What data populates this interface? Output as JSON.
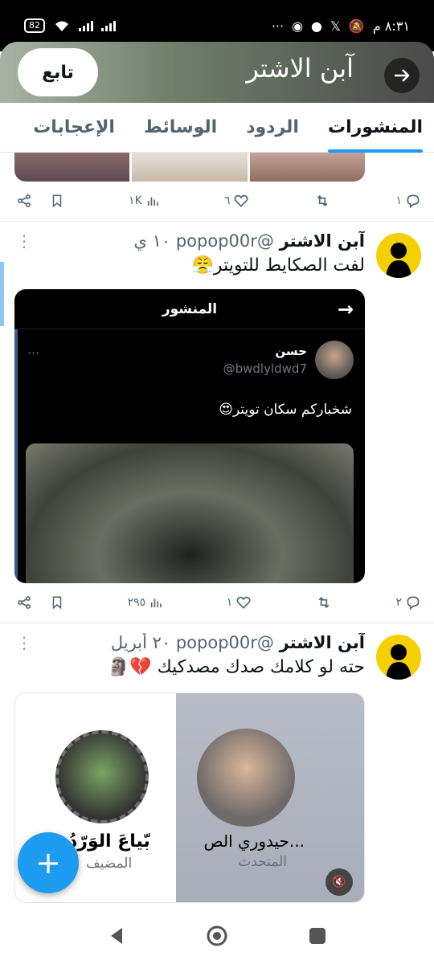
{
  "status_bar": {
    "time": "٨:٣١ م",
    "battery": "82",
    "dots": "···"
  },
  "header": {
    "title": "آبن الاشتر",
    "follow_label": "تابع"
  },
  "tabs": [
    {
      "label": "المنشورات",
      "active": true
    },
    {
      "label": "الردود",
      "active": false
    },
    {
      "label": "الوسائط",
      "active": false
    },
    {
      "label": "الإعجابات",
      "active": false
    }
  ],
  "tweet0": {
    "reply_count": "١",
    "like_count": "٦",
    "view_count": "١K"
  },
  "tweet1": {
    "name": "آبن الاشتر",
    "handle": "@popop00r",
    "time": "١٠ ي",
    "text": "لفت الصكايط للتويتر😤",
    "quote": {
      "bar_title": "المنشور",
      "author_name": "حسن",
      "author_handle": "@bwdlyldwd7",
      "text": "شخباركم سكان تويتر😍"
    },
    "reply_count": "٢",
    "like_count": "١",
    "view_count": "٢٩٥"
  },
  "tweet2": {
    "name": "آبن الاشتر",
    "handle": "@popop00r",
    "time": "٢٠ أبريل",
    "text": "حته لو كلامك صدك مصدكيك 💔🗿",
    "space": {
      "speaker_name": "حيدوري الص...",
      "speaker_role": "المتحدث",
      "host_name": "بّياعَ الوَرّدُ",
      "host_role": "المضيف"
    }
  },
  "colors": {
    "accent": "#1d9bf0",
    "avatar_bg": "#f5d000",
    "text_secondary": "#536471"
  }
}
